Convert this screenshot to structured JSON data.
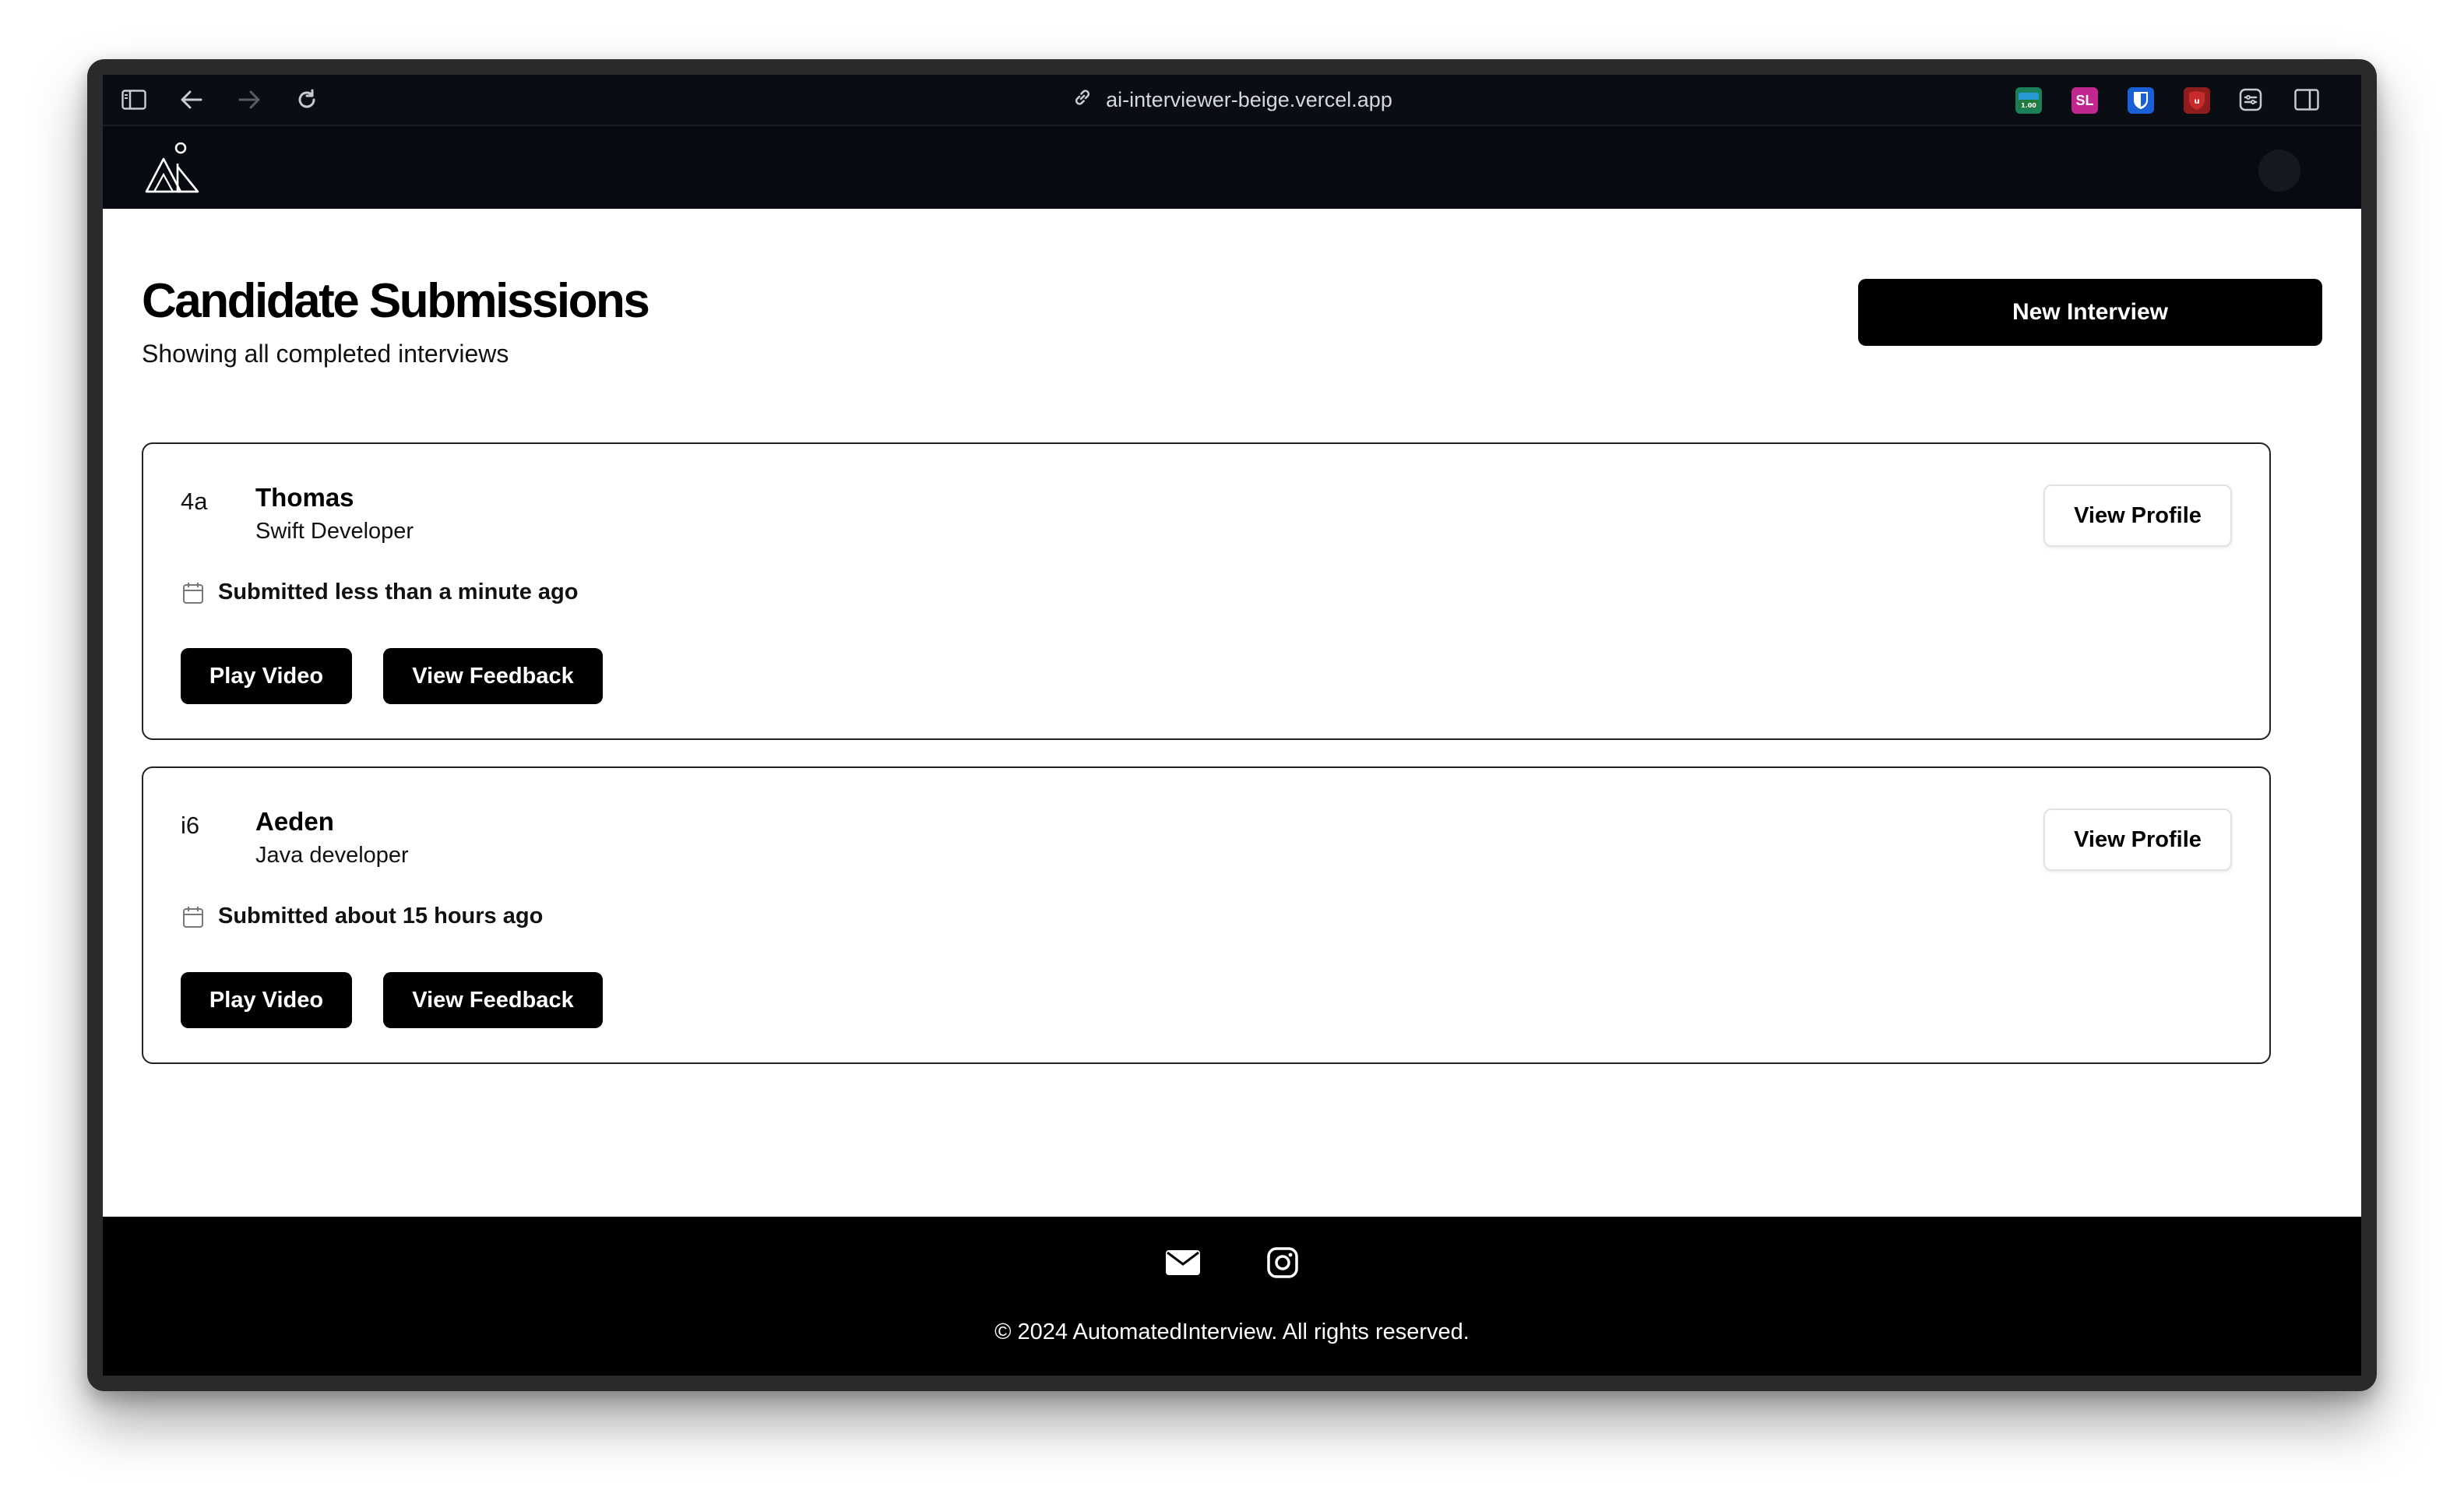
{
  "browser": {
    "url": "ai-interviewer-beige.vercel.app",
    "extensions": [
      {
        "name": "folder-tags-extension-icon",
        "label": "1.00",
        "color": "#1b7f5a"
      },
      {
        "name": "sl-extension-icon",
        "label": "SL",
        "color": "#c2278f"
      },
      {
        "name": "bitwarden-shield-icon",
        "label": "",
        "color": "#1a5fd6"
      },
      {
        "name": "ublock-shield-icon",
        "label": "",
        "color": "#8f1d1d"
      }
    ]
  },
  "page": {
    "title": "Candidate Submissions",
    "subtitle": "Showing all completed interviews",
    "new_interview_label": "New Interview"
  },
  "submissions": [
    {
      "avatar_text": "4a",
      "name": "Thomas",
      "role": "Swift Developer",
      "submitted": "Submitted less than a minute ago",
      "view_profile_label": "View Profile",
      "play_video_label": "Play Video",
      "view_feedback_label": "View Feedback"
    },
    {
      "avatar_text": "i6",
      "name": "Aeden",
      "role": "Java developer",
      "submitted": "Submitted about 15 hours ago",
      "view_profile_label": "View Profile",
      "play_video_label": "Play Video",
      "view_feedback_label": "View Feedback"
    }
  ],
  "footer": {
    "copyright": "© 2024 AutomatedInterview. All rights reserved."
  }
}
